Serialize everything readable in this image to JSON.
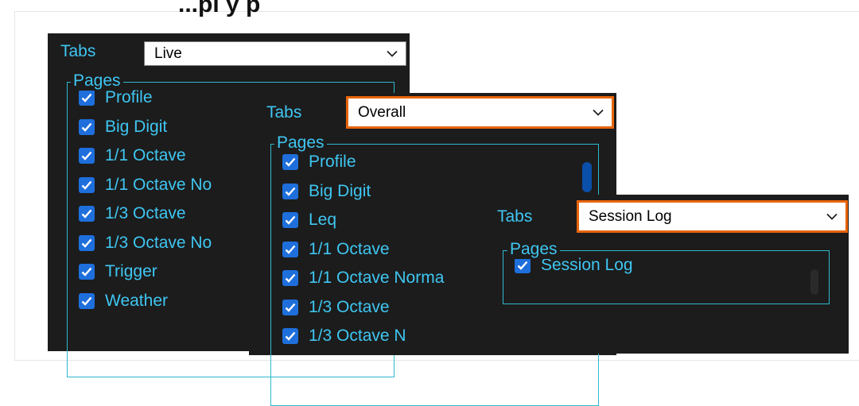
{
  "page_heading": "...pl y p",
  "panels": {
    "live": {
      "tabs_label": "Tabs",
      "selected_tab": "Live",
      "pages_label": "Pages",
      "items": [
        "Profile",
        "Big Digit",
        "1/1 Octave",
        "1/1 Octave No",
        "1/3 Octave",
        "1/3 Octave No",
        "Trigger",
        "Weather"
      ]
    },
    "overall": {
      "tabs_label": "Tabs",
      "selected_tab": "Overall",
      "pages_label": "Pages",
      "items": [
        "Profile",
        "Big Digit",
        "Leq",
        "1/1 Octave",
        "1/1 Octave Norma",
        "1/3 Octave",
        "1/3 Octave N"
      ]
    },
    "session_log": {
      "tabs_label": "Tabs",
      "selected_tab": "Session Log",
      "pages_label": "Pages",
      "items": [
        "Session Log"
      ]
    }
  },
  "colors": {
    "panel_bg": "#1c1c1c",
    "accent_text": "#3fc6f2",
    "checkbox": "#1e6fdc",
    "highlight_border": "#e8650a"
  },
  "icons": {
    "dropdown": "chevron-down-icon",
    "checkbox": "checkmark-icon"
  }
}
